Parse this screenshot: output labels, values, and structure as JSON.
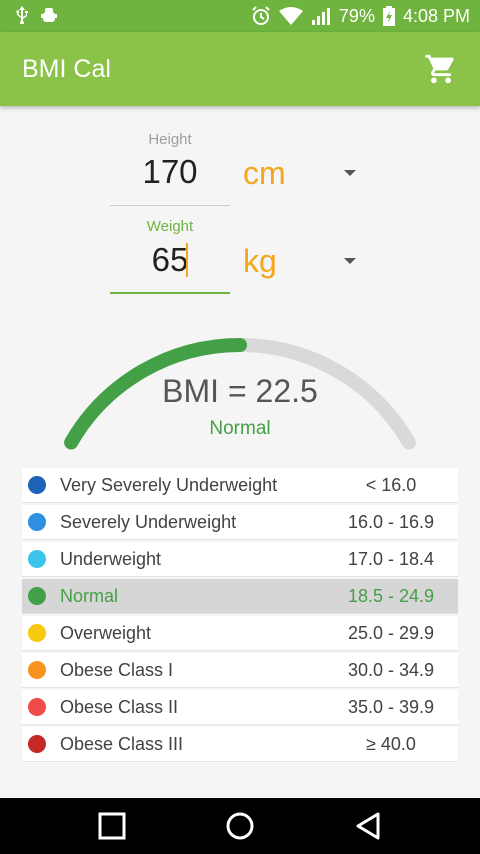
{
  "status_bar": {
    "battery": "79%",
    "time": "4:08 PM"
  },
  "app_bar": {
    "title": "BMI Cal"
  },
  "height": {
    "label": "Height",
    "value": "170",
    "unit": "cm"
  },
  "weight": {
    "label": "Weight",
    "value": "65",
    "unit": "kg"
  },
  "result": {
    "bmi_text": "BMI = 22.5",
    "category": "Normal",
    "gauge_fraction": 0.5
  },
  "categories": [
    {
      "name": "Very Severely Underweight",
      "range": "< 16.0",
      "color": "#1e63b8",
      "highlight": false
    },
    {
      "name": "Severely Underweight",
      "range": "16.0 - 16.9",
      "color": "#2f8fe2",
      "highlight": false
    },
    {
      "name": "Underweight",
      "range": "17.0 - 18.4",
      "color": "#3cc5ea",
      "highlight": false
    },
    {
      "name": "Normal",
      "range": "18.5 - 24.9",
      "color": "#43a047",
      "highlight": true
    },
    {
      "name": "Overweight",
      "range": "25.0 - 29.9",
      "color": "#f7c90f",
      "highlight": false
    },
    {
      "name": "Obese Class I",
      "range": "30.0 - 34.9",
      "color": "#f7931e",
      "highlight": false
    },
    {
      "name": "Obese Class II",
      "range": "35.0 - 39.9",
      "color": "#ef4b4b",
      "highlight": false
    },
    {
      "name": "Obese Class III",
      "range": "≥ 40.0",
      "color": "#c62828",
      "highlight": false
    }
  ],
  "colors": {
    "primary": "#8bc34a",
    "status_bar": "#6fb43f",
    "accent": "#f4a61c",
    "gauge_fill": "#43a047",
    "gauge_track": "#d9d9d9"
  }
}
